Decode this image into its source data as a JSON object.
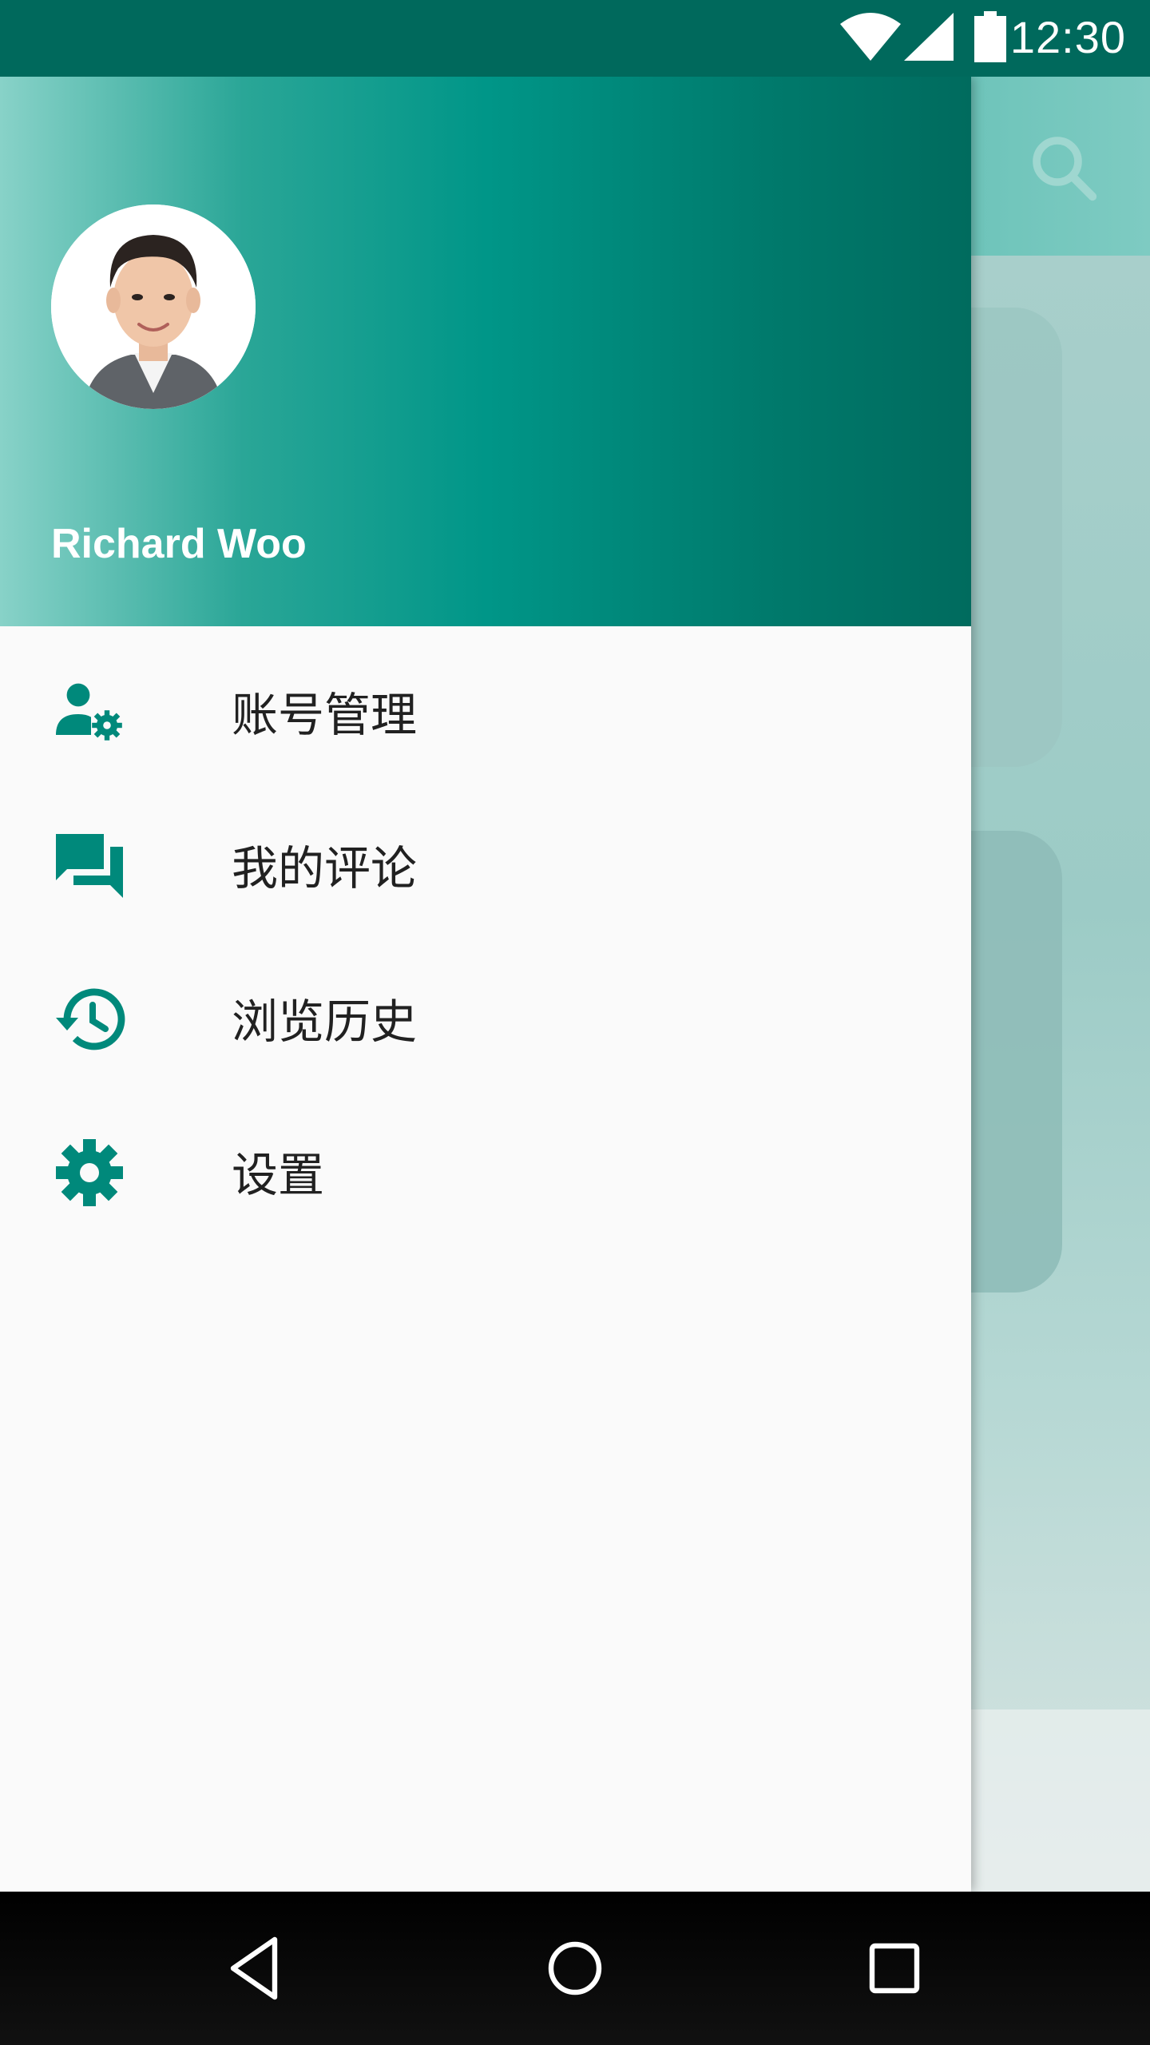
{
  "status_bar": {
    "time": "12:30",
    "icons": [
      "wifi-icon",
      "cellular-signal-icon",
      "battery-icon"
    ]
  },
  "background_app": {
    "toolbar_icon": "search-icon"
  },
  "drawer": {
    "header": {
      "user_name": "Richard Woo",
      "avatar": "avatar"
    },
    "menu": [
      {
        "label": "账号管理",
        "icon": "account-settings-icon"
      },
      {
        "label": "我的评论",
        "icon": "comments-icon"
      },
      {
        "label": "浏览历史",
        "icon": "history-icon"
      },
      {
        "label": "设置",
        "icon": "gear-icon"
      }
    ]
  },
  "nav_bar": {
    "buttons": [
      "back-icon",
      "home-icon",
      "recents-icon"
    ]
  },
  "colors": {
    "status_bar": "#00695c",
    "accent": "#009688",
    "menu_text": "#212121",
    "drawer_bg": "#fafafa"
  }
}
